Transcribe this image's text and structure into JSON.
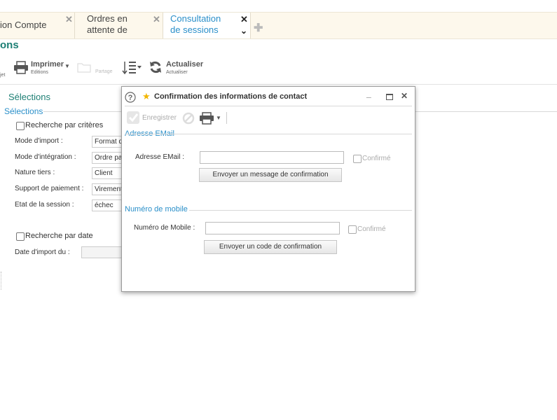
{
  "tabs": [
    {
      "label": "ion Compte"
    },
    {
      "label": "Ordres en attente de"
    },
    {
      "label": "Consultation de sessions"
    }
  ],
  "page": {
    "title": "ons",
    "toolbar": {
      "objet_label": "jet",
      "print_label": "Imprimer",
      "print_sub": "Editions",
      "share_label": "Partage",
      "refresh_label": "Actualiser",
      "refresh_sub": "Actualiser"
    }
  },
  "selections": {
    "heading": "Sélections",
    "subheading": "Sélections",
    "criteria_checkbox": "Recherche par critères",
    "fields": [
      {
        "label": "Mode d'import :",
        "value": "Format d"
      },
      {
        "label": "Mode d'intégration :",
        "value": "Ordre pa"
      },
      {
        "label": "Nature tiers :",
        "value": "Client"
      },
      {
        "label": "Support de paiement :",
        "value": "Virement"
      },
      {
        "label": "Etat de la session :",
        "value": "échec"
      }
    ],
    "date_checkbox": "Recherche par date",
    "date_label": "Date d'import du :",
    "date_value": ""
  },
  "modal": {
    "title": "Confirmation des informations de contact",
    "toolbar": {
      "save_label": "Enregistrer"
    },
    "email_group": "Adresse EMail",
    "email_label": "Adresse EMail :",
    "email_value": "",
    "email_confirmed_label": "Confirmé",
    "email_button": "Envoyer un message de confirmation",
    "mobile_group": "Numéro de mobile",
    "mobile_label": "Numéro de Mobile :",
    "mobile_value": "",
    "mobile_confirmed_label": "Confirmé",
    "mobile_button": "Envoyer un code de confirmation"
  },
  "colors": {
    "accent_teal": "#1d7f74",
    "accent_blue": "#2a8fc9",
    "tab_bg": "#fdf8ec"
  },
  "icons": [
    "close-icon",
    "chevron-down-icon",
    "plus-icon",
    "printer-icon",
    "folder-icon",
    "sort-icon",
    "refresh-icon",
    "help-icon",
    "star-icon",
    "check-icon",
    "forbidden-icon",
    "minimize-icon",
    "maximize-icon"
  ]
}
